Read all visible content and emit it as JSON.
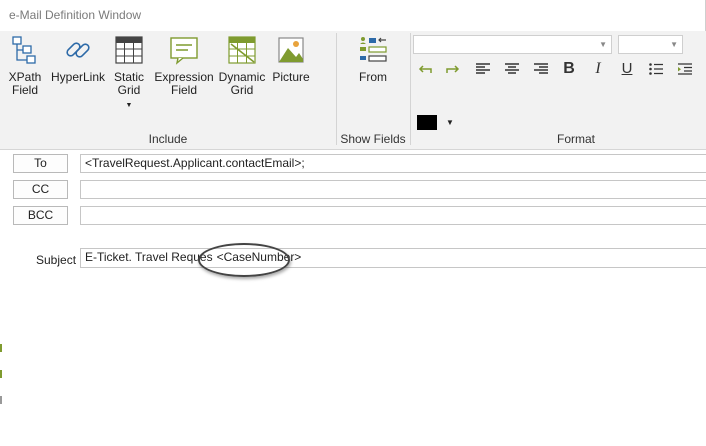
{
  "window": {
    "title": "e-Mail Definition Window"
  },
  "ribbon": {
    "groups": {
      "include": "Include",
      "show_fields": "Show Fields",
      "format": "Format"
    },
    "buttons": {
      "xpath_field": "XPath\nField",
      "hyperlink": "HyperLink",
      "static_grid": "Static\nGrid",
      "expression_field": "Expression\nField",
      "dynamic_grid": "Dynamic\nGrid",
      "picture": "Picture",
      "from": "From"
    },
    "format": {
      "font_family_value": "",
      "font_size_value": "",
      "bold": "B",
      "italic": "I",
      "underline": "U",
      "font_color": "#000000"
    }
  },
  "mail": {
    "to_label": "To",
    "to_value": "<TravelRequest.Applicant.contactEmail>;",
    "cc_label": "CC",
    "cc_value": "",
    "bcc_label": "BCC",
    "bcc_value": "",
    "subject_label": "Subject",
    "subject_value": "E-Ticket. Travel Reques",
    "subject_token": "<CaseNumber>"
  },
  "colors": {
    "accent_green": "#7f9b2f",
    "accent_blue": "#2d6aa8",
    "ribbon_bg": "#f2f2f2"
  }
}
